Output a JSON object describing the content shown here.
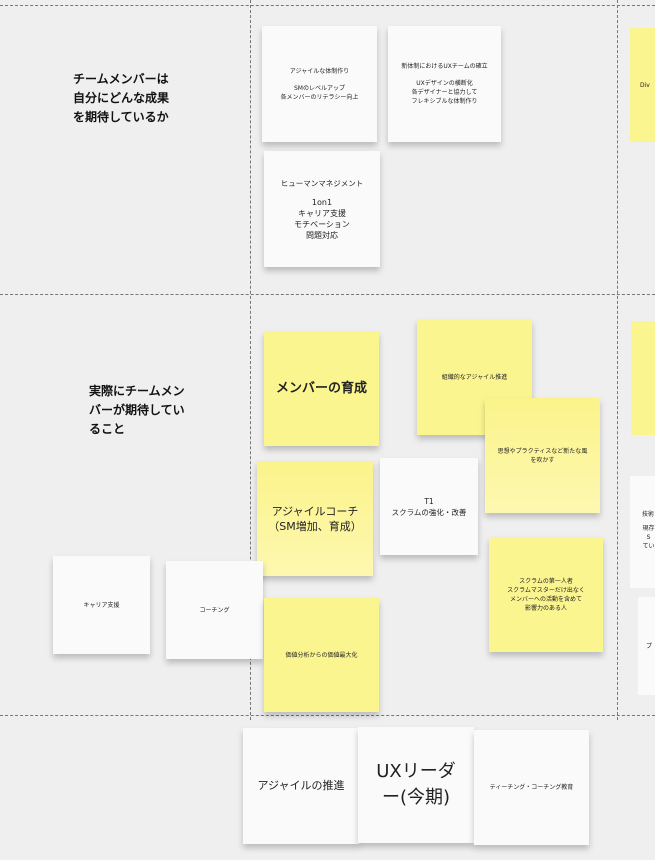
{
  "rows": {
    "row1_label": "チームメンバーは\n自分にどんな成果\nを期待しているか",
    "row2_label": "実際にチームメン\nバーが期待してい\nること"
  },
  "notes": {
    "agile_structure": {
      "title": "アジャイルな体制作り",
      "body": "SMのレベルアップ\n各メンバーのリテラシー向上"
    },
    "ux_team": {
      "title": "新体制におけるUXチームの確立",
      "body": "UXデザインの横断化\n各デザイナーと協力して\nフレキシブルな体制作り"
    },
    "human_mgmt": {
      "title": "ヒューマンマネジメント",
      "body": "1on1\nキャリア支援\nモチベーション\n問題対応"
    },
    "member_growth": "メンバーの育成",
    "cross_agile": "組織的なアジャイル推進",
    "new_wind": "思想やプラクティスなど新たな風\nを吹かす",
    "agile_coach": "アジャイルコーチ\n（SM増加、育成）",
    "t1_scrum": {
      "title": "T1",
      "body": "スクラムの強化・改善"
    },
    "scrum_expert": "スクラムの第一人者\nスクラムマスターだけ出なく\nメンバーへの活動を含めて\n影響力のある人",
    "career_support": "キャリア支援",
    "coaching": "コーチング",
    "value_max": "価値分析からの価値最大化",
    "agile_promo": "アジャイルの推進",
    "ux_leader": "UXリーダ\nー(今期)",
    "teaching": "ティーチング・コーチング教育"
  },
  "edge_notes": {
    "div": "Div",
    "tech": "技術",
    "current": "現存S\nてい",
    "pu": "プ"
  }
}
